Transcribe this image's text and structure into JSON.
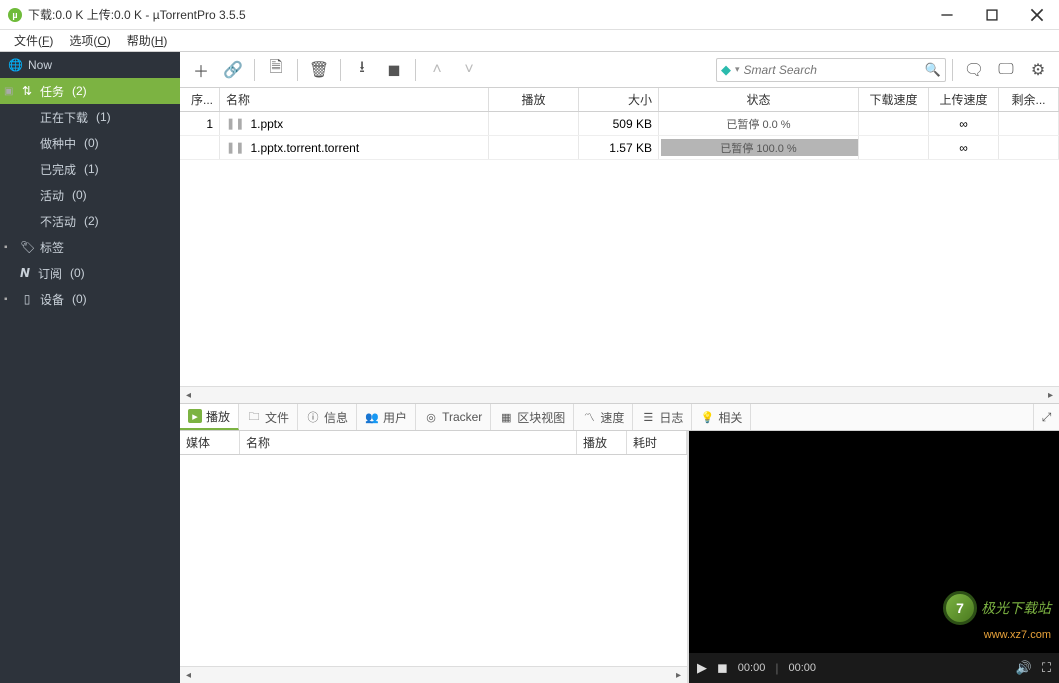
{
  "window": {
    "title": "下载:0.0 K 上传:0.0 K - µTorrentPro 3.5.5"
  },
  "menu": {
    "file": "文件(F)",
    "options": "选项(O)",
    "help": "帮助(H)"
  },
  "sidebar": {
    "now": "Now",
    "tasks": {
      "label": "任务",
      "count": "(2)"
    },
    "downloading": {
      "label": "正在下载",
      "count": "(1)"
    },
    "seeding": {
      "label": "做种中",
      "count": "(0)"
    },
    "completed": {
      "label": "已完成",
      "count": "(1)"
    },
    "active": {
      "label": "活动",
      "count": "(0)"
    },
    "inactive": {
      "label": "不活动",
      "count": "(2)"
    },
    "labels": "标签",
    "feeds": {
      "label": "订阅",
      "count": "(0)"
    },
    "devices": {
      "label": "设备",
      "count": "(0)"
    }
  },
  "search": {
    "placeholder": "Smart Search"
  },
  "columns": {
    "idx": "序...",
    "name": "名称",
    "play": "播放",
    "size": "大小",
    "status": "状态",
    "dspeed": "下载速度",
    "uspeed": "上传速度",
    "remain": "剩余..."
  },
  "rows": [
    {
      "idx": "1",
      "name": "1.pptx",
      "size": "509 KB",
      "status": "已暂停 0.0 %",
      "pct": 0,
      "remain": "∞"
    },
    {
      "idx": "",
      "name": "1.pptx.torrent.torrent",
      "size": "1.57 KB",
      "status": "已暂停 100.0 %",
      "pct": 100,
      "remain": "∞"
    }
  ],
  "tabs": {
    "play": "播放",
    "files": "文件",
    "info": "信息",
    "peers": "用户",
    "tracker": "Tracker",
    "pieces": "区块视图",
    "speed": "速度",
    "log": "日志",
    "related": "相关"
  },
  "mediaCols": {
    "media": "媒体",
    "name": "名称",
    "play": "播放",
    "dur": "耗时"
  },
  "player": {
    "t1": "00:00",
    "t2": "00:00",
    "wm_text": "极光下载站",
    "wm_url": "www.xz7.com"
  }
}
